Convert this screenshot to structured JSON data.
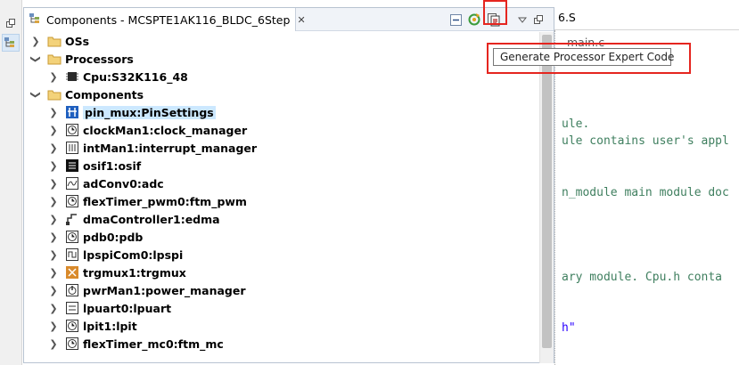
{
  "components_view": {
    "title": "Components - MCSPTE1AK116_BLDC_6Step",
    "close_glyph": "✕",
    "tree": [
      {
        "label": "OSs",
        "expanded": false,
        "icon": "folder-icon",
        "level": 0
      },
      {
        "label": "Processors",
        "expanded": true,
        "icon": "folder-icon",
        "level": 0
      },
      {
        "label": "Cpu:S32K116_48",
        "expanded": false,
        "icon": "cpu-icon",
        "level": 1
      },
      {
        "label": "Components",
        "expanded": true,
        "icon": "folder-icon",
        "level": 0
      },
      {
        "label": "pin_mux:PinSettings",
        "expanded": false,
        "icon": "pin-icon",
        "level": 1,
        "selected": true
      },
      {
        "label": "clockMan1:clock_manager",
        "expanded": false,
        "icon": "clock-icon",
        "level": 1
      },
      {
        "label": "intMan1:interrupt_manager",
        "expanded": false,
        "icon": "component-icon",
        "level": 1
      },
      {
        "label": "osif1:osif",
        "expanded": false,
        "icon": "osif-icon",
        "level": 1
      },
      {
        "label": "adConv0:adc",
        "expanded": false,
        "icon": "adc-icon",
        "level": 1
      },
      {
        "label": "flexTimer_pwm0:ftm_pwm",
        "expanded": false,
        "icon": "timer-icon",
        "level": 1
      },
      {
        "label": "dmaController1:edma",
        "expanded": false,
        "icon": "dma-icon",
        "level": 1
      },
      {
        "label": "pdb0:pdb",
        "expanded": false,
        "icon": "component-icon",
        "level": 1
      },
      {
        "label": "lpspiCom0:lpspi",
        "expanded": false,
        "icon": "spi-icon",
        "level": 1
      },
      {
        "label": "trgmux1:trgmux",
        "expanded": false,
        "icon": "trgmux-icon",
        "level": 1
      },
      {
        "label": "pwrMan1:power_manager",
        "expanded": false,
        "icon": "power-icon",
        "level": 1
      },
      {
        "label": "lpuart0:lpuart",
        "expanded": false,
        "icon": "component-icon",
        "level": 1
      },
      {
        "label": "lpit1:lpit",
        "expanded": false,
        "icon": "component-icon",
        "level": 1
      },
      {
        "label": "flexTimer_mc0:ftm_mc",
        "expanded": false,
        "icon": "timer-icon",
        "level": 1
      }
    ]
  },
  "tooltip": {
    "text": "Generate Processor Expert Code"
  },
  "editor": {
    "tabs": [
      "6.S",
      "main.c"
    ],
    "lines": [
      {
        "text": "ule.",
        "style": "comment"
      },
      {
        "text": "ule contains user's appl",
        "style": "comment"
      },
      {
        "text": "n_module main module doc",
        "style": "comment"
      },
      {
        "text": "ary module. Cpu.h conta",
        "style": "comment"
      },
      {
        "text": "h\"",
        "style": "string"
      }
    ]
  }
}
